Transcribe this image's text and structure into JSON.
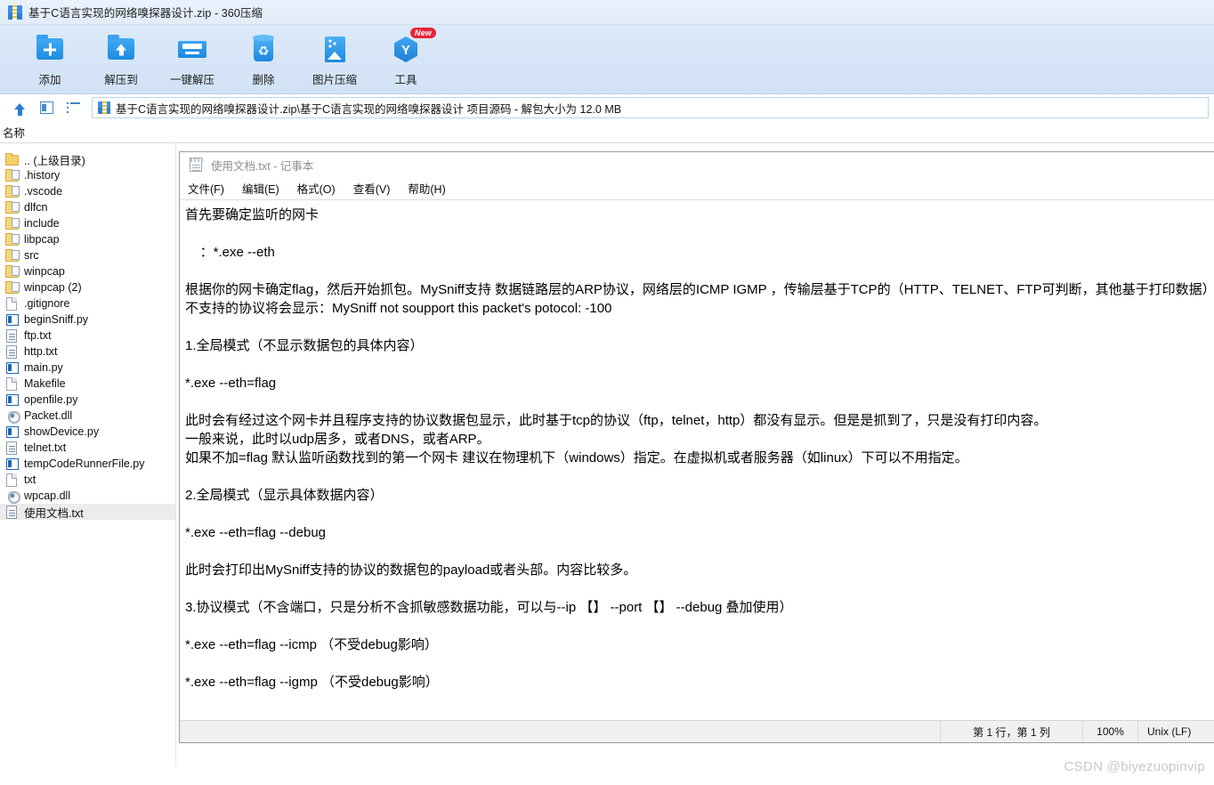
{
  "window": {
    "title": "基于C语言实现的网络嗅探器设计.zip - 360压缩",
    "title_icon": "zip-archive-icon"
  },
  "toolbar": {
    "buttons": [
      {
        "label": "添加",
        "icon": "folder-add-icon",
        "badge": ""
      },
      {
        "label": "解压到",
        "icon": "folder-extract-icon",
        "badge": ""
      },
      {
        "label": "一键解压",
        "icon": "one-click-extract-icon",
        "badge": ""
      },
      {
        "label": "删除",
        "icon": "trash-icon",
        "badge": ""
      },
      {
        "label": "图片压缩",
        "icon": "image-compress-icon",
        "badge": ""
      },
      {
        "label": "工具",
        "icon": "tools-hexagon-icon",
        "badge": "New"
      }
    ]
  },
  "pathbar": {
    "up_icon": "arrow-up-icon",
    "pane_icon": "preview-pane-icon",
    "list_icon": "list-view-icon",
    "path": "基于C语言实现的网络嗅探器设计.zip\\基于C语言实现的网络嗅探器设计 项目源码 - 解包大小为 12.0 MB"
  },
  "columns": {
    "name": "名称"
  },
  "filelist": [
    {
      "name": ".. (上级目录)",
      "icon": "folder-icon",
      "selected": false
    },
    {
      "name": ".history",
      "icon": "folder-doc-icon",
      "selected": false
    },
    {
      "name": ".vscode",
      "icon": "folder-doc-icon",
      "selected": false
    },
    {
      "name": "dlfcn",
      "icon": "folder-doc-icon",
      "selected": false
    },
    {
      "name": "include",
      "icon": "folder-doc-icon",
      "selected": false
    },
    {
      "name": "libpcap",
      "icon": "folder-doc-icon",
      "selected": false
    },
    {
      "name": "src",
      "icon": "folder-doc-icon",
      "selected": false
    },
    {
      "name": "winpcap",
      "icon": "folder-doc-icon",
      "selected": false
    },
    {
      "name": "winpcap (2)",
      "icon": "folder-doc-icon",
      "selected": false
    },
    {
      "name": ".gitignore",
      "icon": "file-icon",
      "selected": false
    },
    {
      "name": "beginSniff.py",
      "icon": "python-file-icon",
      "selected": false
    },
    {
      "name": "ftp.txt",
      "icon": "text-file-icon",
      "selected": false
    },
    {
      "name": "http.txt",
      "icon": "text-file-icon",
      "selected": false
    },
    {
      "name": "main.py",
      "icon": "python-file-icon",
      "selected": false
    },
    {
      "name": "Makefile",
      "icon": "file-icon",
      "selected": false
    },
    {
      "name": "openfile.py",
      "icon": "python-file-icon",
      "selected": false
    },
    {
      "name": "Packet.dll",
      "icon": "dll-file-icon",
      "selected": false
    },
    {
      "name": "showDevice.py",
      "icon": "python-file-icon",
      "selected": false
    },
    {
      "name": "telnet.txt",
      "icon": "text-file-icon",
      "selected": false
    },
    {
      "name": "tempCodeRunnerFile.py",
      "icon": "python-file-icon",
      "selected": false
    },
    {
      "name": "txt",
      "icon": "file-icon",
      "selected": false
    },
    {
      "name": "wpcap.dll",
      "icon": "dll-file-icon",
      "selected": false
    },
    {
      "name": "使用文档.txt",
      "icon": "text-file-icon",
      "selected": true
    }
  ],
  "notepad": {
    "title": "使用文档.txt - 记事本",
    "title_icon": "notepad-icon",
    "menu": [
      "文件(F)",
      "编辑(E)",
      "格式(O)",
      "查看(V)",
      "帮助(H)"
    ],
    "content": "首先要确定监听的网卡\n\n    ：*.exe --eth\n\n根据你的网卡确定flag，然后开始抓包。MySniff支持 数据链路层的ARP协议，网络层的ICMP IGMP ，传输层基于TCP的（HTTP、TELNET、FTP可判断，其他基于打印数据）和基于UDP的（DNS协议、DHCP协议可判断，其他协议只是打印数据）选择分析。\n不支持的协议将会显示：MySniff not soupport this packet's potocol: -100\n\n1.全局模式（不显示数据包的具体内容）\n\n*.exe --eth=flag\n\n此时会有经过这个网卡并且程序支持的协议数据包显示，此时基于tcp的协议（ftp，telnet，http）都没有显示。但是是抓到了，只是没有打印内容。\n一般来说，此时以udp居多，或者DNS，或者ARP。\n如果不加=flag 默认监听函数找到的第一个网卡 建议在物理机下（windows）指定。在虚拟机或者服务器（如linux）下可以不用指定。\n\n2.全局模式（显示具体数据内容）\n\n*.exe --eth=flag --debug\n\n此时会打印出MySniff支持的协议的数据包的payload或者头部。内容比较多。\n\n3.协议模式（不含端口，只是分析不含抓敏感数据功能，可以与--ip 【】 --port 【】 --debug 叠加使用）\n\n*.exe --eth=flag --icmp （不受debug影响）\n\n*.exe --eth=flag --igmp （不受debug影响）",
    "status": {
      "line_col": "第 1 行，第 1 列",
      "zoom": "100%",
      "eol": "Unix (LF)"
    }
  },
  "watermark": "CSDN @biyezuopinvip",
  "colors": {
    "toolbar_bg": "#d6e5f7",
    "titlebar_bg": "#e5eff9",
    "accent_blue": "#1d8ce0",
    "badge_red": "#e8253a",
    "selection_gray": "#ececec",
    "watermark_gray": "#c9c9c9"
  }
}
